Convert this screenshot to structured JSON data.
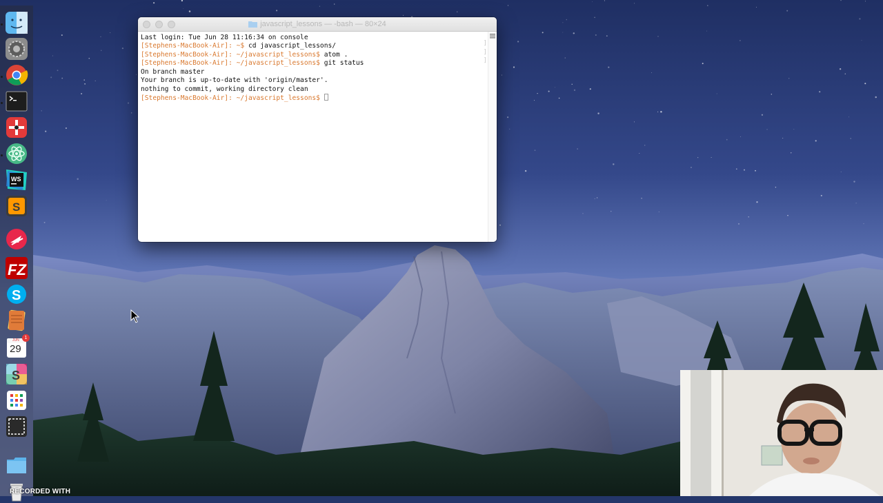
{
  "window": {
    "title": "javascript_lessons — -bash — 80×24"
  },
  "terminal": {
    "last_login": "Last login: Tue Jun 28 11:16:34 on console",
    "prompt_home": "[Stephens-MacBook-Air]: ~$",
    "cmd_cd": " cd javascript_lessons/",
    "prompt_dir": "[Stephens-MacBook-Air]: ~/javascript_lessons$",
    "cmd_atom": " atom .",
    "cmd_git": " git status",
    "out_branch": "On branch master",
    "out_uptodate": "Your branch is up-to-date with 'origin/master'.",
    "out_clean": "nothing to commit, working directory clean"
  },
  "dock": {
    "items": [
      {
        "name": "finder-icon",
        "running": true
      },
      {
        "name": "system-preferences-icon",
        "running": false
      },
      {
        "name": "chrome-icon",
        "running": true
      },
      {
        "name": "terminal-icon",
        "running": true
      },
      {
        "name": "time-tracker-icon",
        "running": false
      },
      {
        "name": "atom-icon",
        "running": true
      },
      {
        "name": "webstorm-icon",
        "running": false
      },
      {
        "name": "sublime-text-icon",
        "running": false
      },
      {
        "name": "pocketcasts-icon",
        "running": false
      },
      {
        "name": "filezilla-icon",
        "running": false
      },
      {
        "name": "skype-icon",
        "running": false
      },
      {
        "name": "notes-icon",
        "running": false
      },
      {
        "name": "calendar-icon",
        "running": false
      },
      {
        "name": "slack-icon",
        "running": false
      },
      {
        "name": "launchpad-icon",
        "running": false
      },
      {
        "name": "screenshot-icon",
        "running": false
      },
      {
        "name": "downloads-folder-icon",
        "running": false
      },
      {
        "name": "trash-icon",
        "running": false
      }
    ],
    "calendar": {
      "month": "JUN",
      "day": "29",
      "badge": "1"
    }
  },
  "recorder": {
    "watermark": "RECORDED WITH"
  },
  "colors": {
    "prompt": "#d9782e",
    "terminal_bg": "#ffffff",
    "sky_top": "#24366a",
    "sky_bottom": "#6f85c4"
  }
}
